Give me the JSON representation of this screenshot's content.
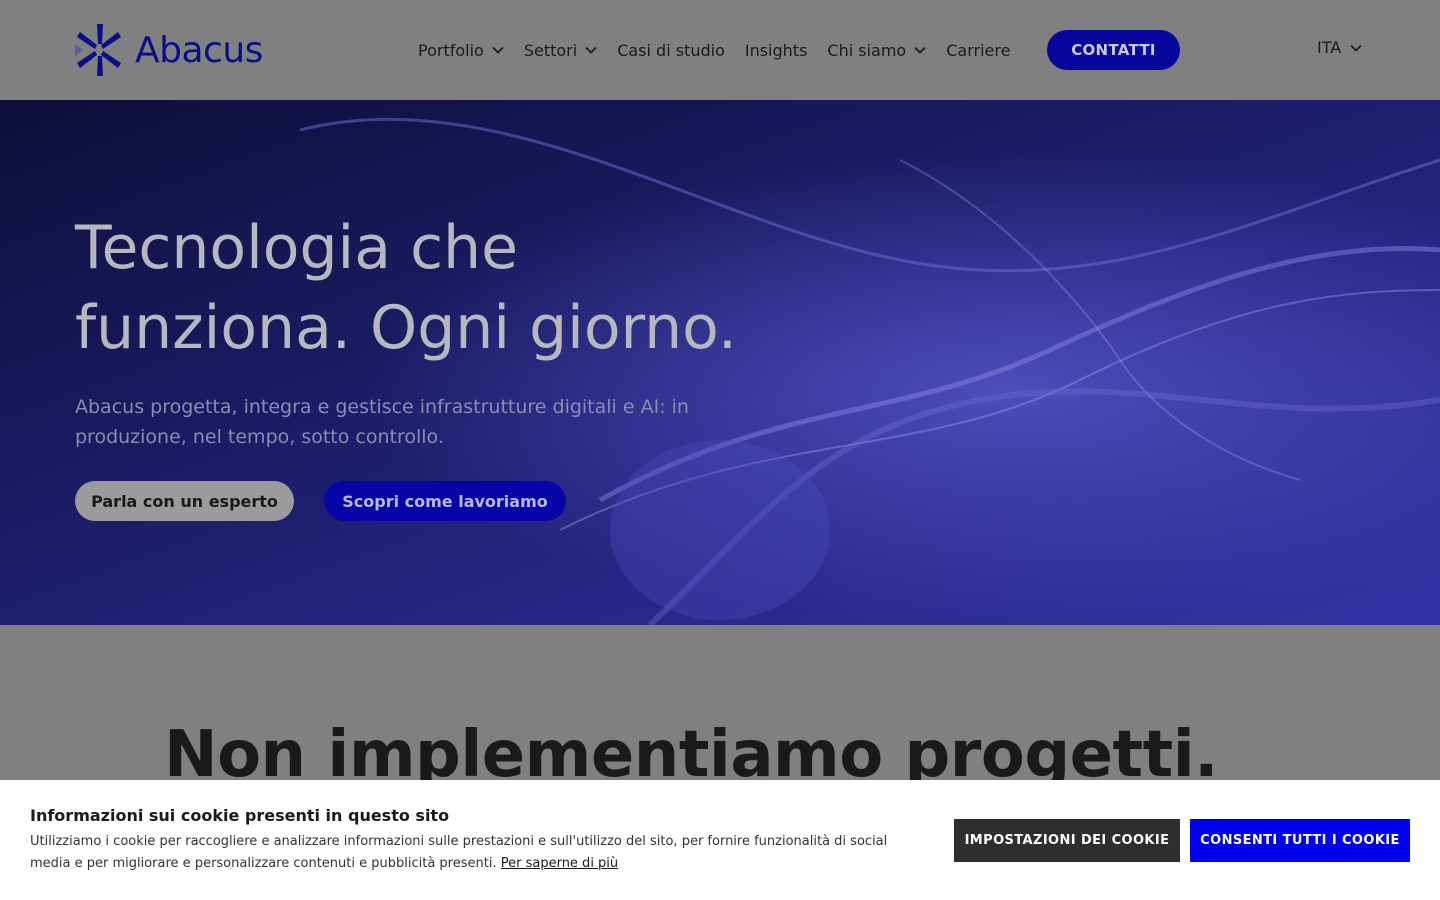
{
  "header": {
    "logo_text": "Abacus",
    "nav": [
      {
        "label": "Portfolio",
        "dropdown": true
      },
      {
        "label": "Settori",
        "dropdown": true
      },
      {
        "label": "Casi di studio",
        "dropdown": false
      },
      {
        "label": "Insights",
        "dropdown": false
      },
      {
        "label": "Chi siamo",
        "dropdown": true
      },
      {
        "label": "Carriere",
        "dropdown": false
      }
    ],
    "contact_label": "CONTATTI",
    "language": "ITA"
  },
  "hero": {
    "title_line1": "Tecnologia che",
    "title_line2": "funziona. Ogni giorno.",
    "subtitle": "Abacus progetta, integra e gestisce infrastrutture digitali e AI: in produzione, nel tempo, sotto controllo.",
    "btn_expert": "Parla con un esperto",
    "btn_how": "Scopri come lavoriamo"
  },
  "section": {
    "title": "Non implementiamo progetti."
  },
  "cookie": {
    "title": "Informazioni sui cookie presenti in questo sito",
    "text": "Utilizziamo i cookie per raccogliere e analizzare informazioni sulle prestazioni e sull'utilizzo del sito, per fornire funzionalità di social media e per migliorare e personalizzare contenuti e pubblicità presenti.",
    "link": "Per saperne di più",
    "btn_settings": "IMPOSTAZIONI DEI COOKIE",
    "btn_accept": "CONSENTI TUTTI I COOKIE"
  },
  "colors": {
    "brand": "#0a0e8a",
    "accent": "#07079e",
    "cookie_accept": "#0000ee",
    "cookie_settings": "#2e2e2e"
  }
}
